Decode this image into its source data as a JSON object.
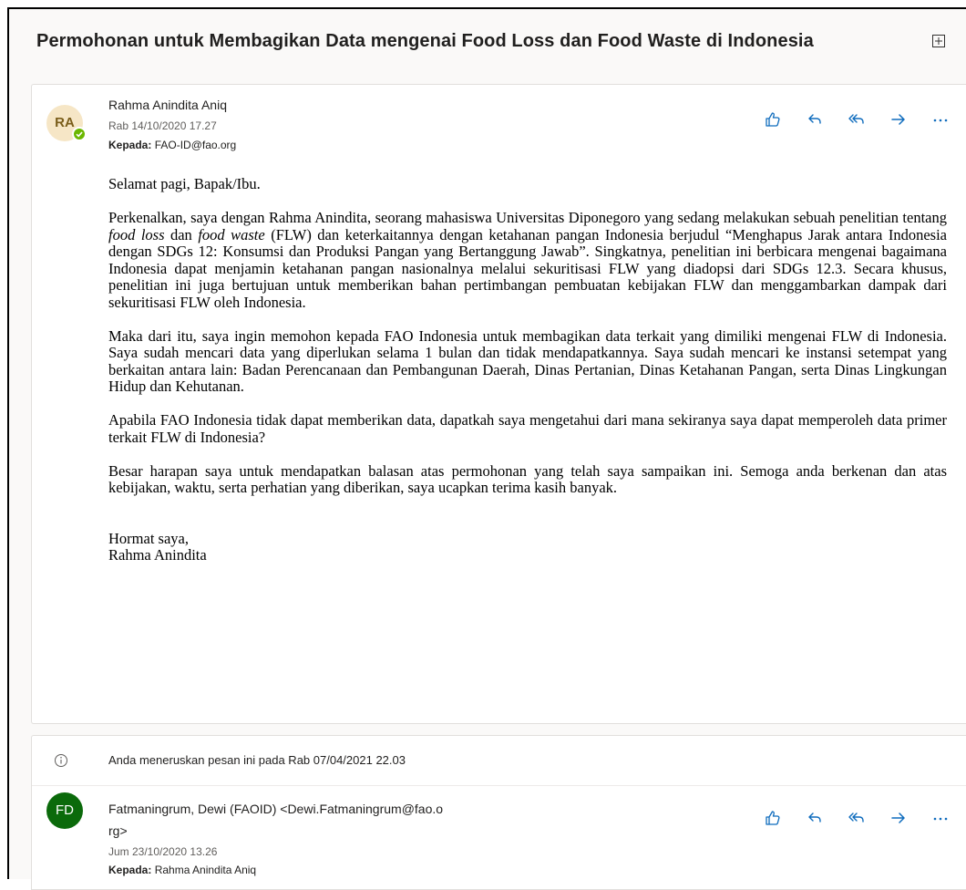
{
  "subject": "Permohonan untuk Membagikan Data mengenai Food Loss dan Food Waste di Indonesia",
  "message1": {
    "avatar_initials": "RA",
    "sender": "Rahma Anindita Aniq",
    "date": "Rab 14/10/2020 17.27",
    "to_label": "Kepada:",
    "to_value": "FAO-ID@fao.org",
    "greeting": "Selamat pagi, Bapak/Ibu.",
    "p1_a": "Perkenalkan, saya dengan Rahma Anindita, seorang mahasiswa Universitas Diponegoro yang sedang melakukan sebuah penelitian tentang ",
    "p1_em1": "food loss",
    "p1_b": " dan ",
    "p1_em2": "food waste",
    "p1_c": " (FLW) dan keterkaitannya dengan ketahanan pangan Indonesia berjudul “Menghapus Jarak antara Indonesia dengan SDGs 12: Konsumsi dan Produksi Pangan yang Bertanggung Jawab”. Singkatnya, penelitian ini berbicara mengenai bagaimana Indonesia dapat menjamin ketahanan pangan nasionalnya melalui sekuritisasi FLW yang diadopsi dari SDGs 12.3. Secara khusus, penelitian ini juga bertujuan untuk memberikan bahan pertimbangan pembuatan kebijakan FLW dan menggambarkan dampak  dari sekuritisasi FLW oleh Indonesia.",
    "p2": "Maka dari itu, saya ingin memohon kepada FAO Indonesia untuk membagikan data terkait yang dimiliki mengenai FLW di Indonesia. Saya sudah mencari data yang diperlukan selama 1 bulan dan tidak mendapatkannya. Saya sudah mencari ke instansi setempat yang berkaitan antara lain: Badan Perencanaan dan Pembangunan Daerah, Dinas Pertanian, Dinas Ketahanan Pangan, serta Dinas Lingkungan Hidup dan Kehutanan.",
    "p3": "Apabila FAO Indonesia tidak dapat memberikan data, dapatkah saya mengetahui dari mana sekiranya saya dapat memperoleh data primer terkait FLW di Indonesia?",
    "p4": "Besar harapan saya untuk mendapatkan balasan atas permohonan yang telah saya sampaikan ini. Semoga anda berkenan dan atas kebijakan, waktu, serta perhatian yang diberikan, saya ucapkan terima kasih banyak.",
    "closing1": "Hormat saya,",
    "closing2": "Rahma Anindita"
  },
  "message2": {
    "forward_notice": "Anda meneruskan pesan ini pada Rab 07/04/2021 22.03",
    "avatar_initials": "FD",
    "sender_line1": "Fatmaningrum, Dewi (FAOID) <Dewi.Fatmaningrum@fao.o",
    "sender_line2": "rg>",
    "date": "Jum 23/10/2020 13.26",
    "to_label": "Kepada:",
    "to_value": "Rahma Anindita Aniq"
  },
  "actions": [
    "like-icon",
    "reply-icon",
    "reply-all-icon",
    "forward-icon",
    "more-icon"
  ],
  "colors": {
    "accent": "#0f6cbd",
    "presence": "#6bb700",
    "fd_avatar": "#0b6a0b",
    "ra_avatar": "#f6e6c6"
  }
}
